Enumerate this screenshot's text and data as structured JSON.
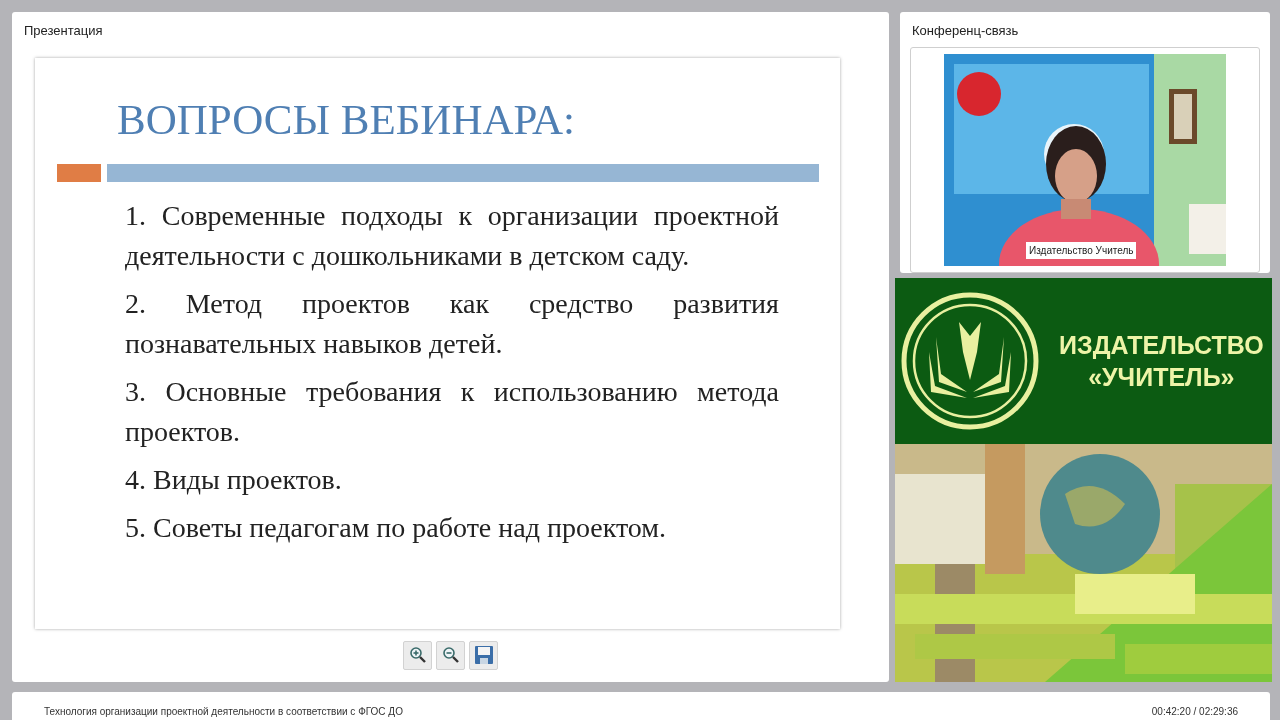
{
  "presentation": {
    "title": "Презентация",
    "slide": {
      "heading": "ВОПРОСЫ ВЕБИНАРА:",
      "items": [
        "1. Современные подходы к организации проектной деятельности с дошкольниками в детском саду.",
        "2. Метод проектов как средство развития познавательных навыков детей.",
        "3. Основные требования к использованию метода проектов.",
        "4. Виды проектов.",
        "5. Советы педагогам по работе над проектом."
      ]
    },
    "tools": [
      {
        "kind": "zoom-in"
      },
      {
        "kind": "zoom-out"
      },
      {
        "kind": "save"
      }
    ]
  },
  "conference": {
    "title": "Конференц-связь",
    "video": {
      "kind": "picture",
      "speaker": "Издательство Учитель"
    }
  },
  "banner": {
    "line1": "ИЗДАТЕЛЬСТВО",
    "line2": "«УЧИТЕЛЬ»"
  },
  "status_bar": {
    "webinar_title": "Технология организации проектной деятельности в соответствии с ФГОС ДО",
    "time": "00:42:20 / 02:29:36"
  }
}
